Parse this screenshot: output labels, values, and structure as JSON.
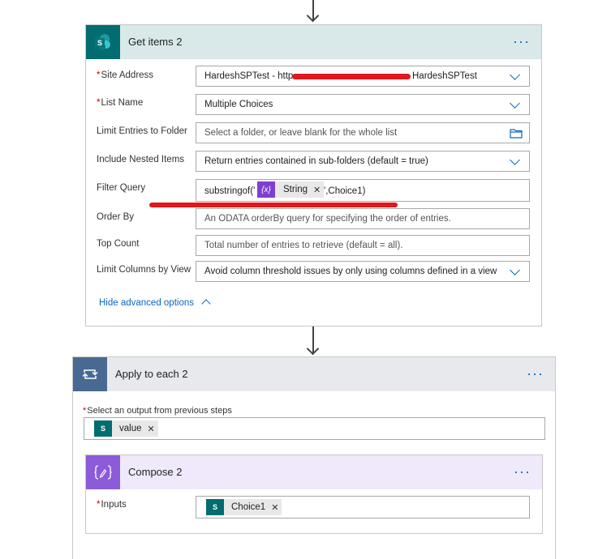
{
  "get_items": {
    "title": "Get items 2",
    "menu_label": "···",
    "fields": {
      "site_address": {
        "label": "Site Address",
        "value_prefix": "HardeshSPTest - http",
        "value_suffix": "HardeshSPTest"
      },
      "list_name": {
        "label": "List Name",
        "value": "Multiple Choices"
      },
      "limit_entries": {
        "label": "Limit Entries to Folder",
        "placeholder": "Select a folder, or leave blank for the whole list"
      },
      "include_nested": {
        "label": "Include Nested Items",
        "value": "Return entries contained in sub-folders (default = true)"
      },
      "filter_query": {
        "label": "Filter Query",
        "prefix": "substringof('",
        "token_label": "String",
        "token_badge": "{x}",
        "suffix": "',Choice1)"
      },
      "order_by": {
        "label": "Order By",
        "placeholder": "An ODATA orderBy query for specifying the order of entries."
      },
      "top_count": {
        "label": "Top Count",
        "placeholder": "Total number of entries to retrieve (default = all)."
      },
      "limit_columns": {
        "label": "Limit Columns by View",
        "value": "Avoid column threshold issues by only using columns defined in a view"
      }
    },
    "hide_advanced": "Hide advanced options"
  },
  "apply_each": {
    "title": "Apply to each 2",
    "menu_label": "···",
    "output_label": "Select an output from previous steps",
    "output_token": "value"
  },
  "compose": {
    "title": "Compose 2",
    "menu_label": "···",
    "inputs_label": "Inputs",
    "inputs_token": "Choice1"
  },
  "colors": {
    "sharepoint": "#036c70",
    "expression": "#7e3fd1",
    "link": "#0a66c2",
    "redaction": "#e3161b"
  }
}
